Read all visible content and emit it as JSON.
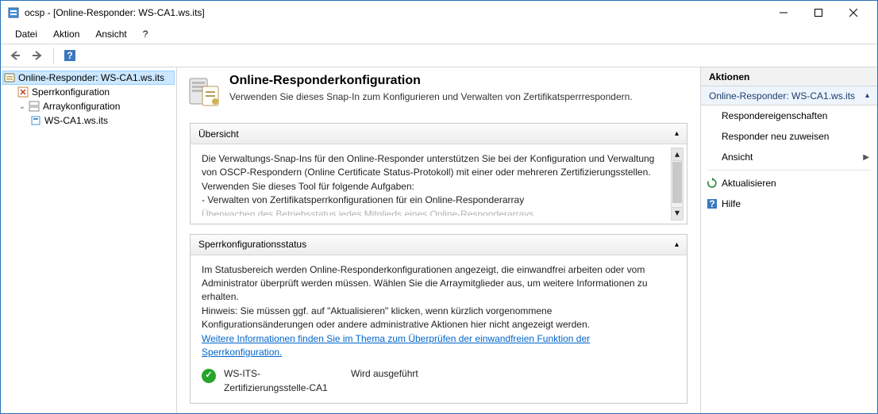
{
  "window": {
    "title": "ocsp - [Online-Responder: WS-CA1.ws.its]"
  },
  "menu": {
    "file": "Datei",
    "action": "Aktion",
    "view": "Ansicht",
    "help": "?"
  },
  "tree": {
    "root": "Online-Responder: WS-CA1.ws.its",
    "node1": "Sperrkonfiguration",
    "node2": "Arraykonfiguration",
    "node2a": "WS-CA1.ws.its"
  },
  "center": {
    "title": "Online-Responderkonfiguration",
    "subtitle": "Verwenden Sie dieses Snap-In zum Konfigurieren und Verwalten von Zertifikatsperrrespondern."
  },
  "overview": {
    "title": "Übersicht",
    "p1": "Die Verwaltungs-Snap-Ins für den Online-Responder unterstützen Sie bei der Konfiguration und Verwaltung von OSCP-Respondern (Online Certificate Status-Protokoll) mit einer oder mehreren Zertifizierungsstellen.",
    "p2": "Verwenden Sie dieses Tool für folgende Aufgaben:",
    "li1": "-  Verwalten von Zertifikatsperrkonfigurationen für ein Online-Responderarray",
    "li2_cut": "   Überwachen des Betriebsstatus jedes Mitglieds eines Online-Responderarrays"
  },
  "revstatus": {
    "title": "Sperrkonfigurationsstatus",
    "p1": "Im Statusbereich werden Online-Responderkonfigurationen angezeigt, die einwandfrei arbeiten oder vom Administrator überprüft werden müssen. Wählen Sie die Arraymitglieder aus, um weitere Informationen zu erhalten.",
    "p2": "Hinweis: Sie müssen ggf. auf \"Aktualisieren\" klicken, wenn kürzlich vorgenommene Konfigurationsänderungen oder andere administrative Aktionen hier nicht angezeigt werden.",
    "link": "Weitere Informationen finden Sie im Thema zum Überprüfen der einwandfreien Funktion der Sperrkonfiguration.",
    "entry_name": "WS-ITS-Zertifizierungsstelle-CA1",
    "entry_state": "Wird ausgeführt"
  },
  "actions": {
    "header": "Aktionen",
    "context": "Online-Responder: WS-CA1.ws.its",
    "props": "Respondereigenschaften",
    "reassign": "Responder neu zuweisen",
    "view": "Ansicht",
    "refresh": "Aktualisieren",
    "help": "Hilfe"
  }
}
